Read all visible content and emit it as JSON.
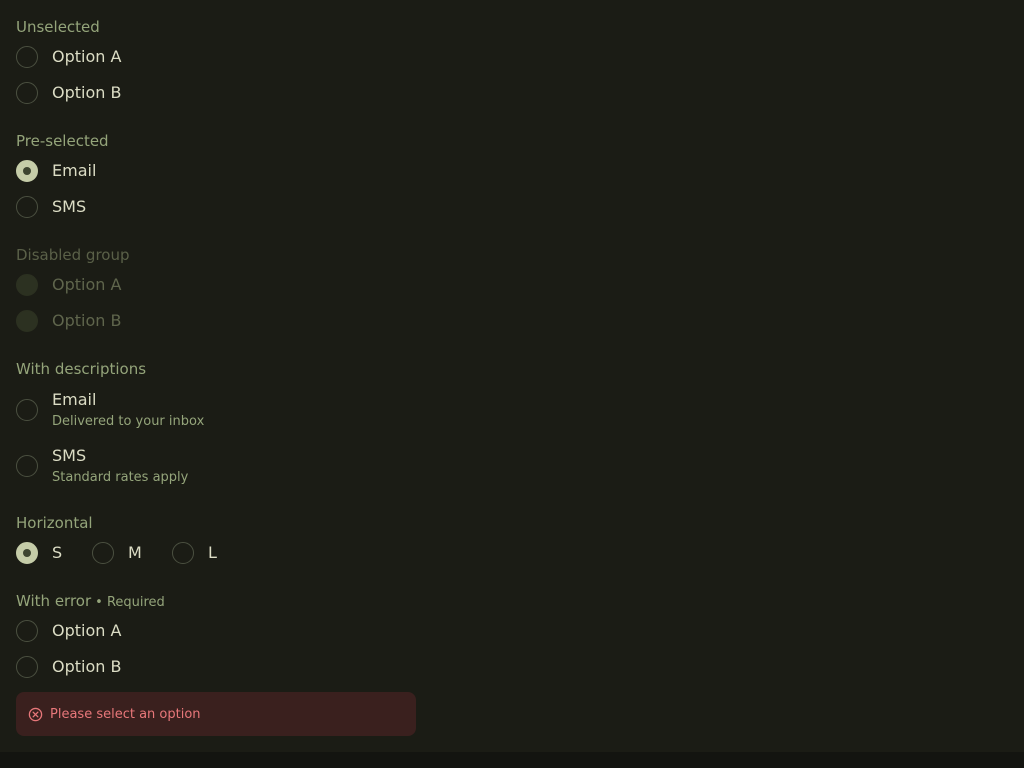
{
  "colors": {
    "background": "#1b1c15",
    "label": "#94a47a",
    "text": "#dcddc5",
    "radio_checked": "#c5cca8",
    "error_bg": "#3a201e",
    "error_text": "#e8777a"
  },
  "groups": {
    "unselected": {
      "label": "Unselected",
      "options": [
        {
          "label": "Option A",
          "checked": false
        },
        {
          "label": "Option B",
          "checked": false
        }
      ]
    },
    "preselected": {
      "label": "Pre-selected",
      "options": [
        {
          "label": "Email",
          "checked": true
        },
        {
          "label": "SMS",
          "checked": false
        }
      ]
    },
    "disabled": {
      "label": "Disabled group",
      "options": [
        {
          "label": "Option A",
          "checked": false
        },
        {
          "label": "Option B",
          "checked": false
        }
      ]
    },
    "descriptions": {
      "label": "With descriptions",
      "options": [
        {
          "label": "Email",
          "description": "Delivered to your inbox",
          "checked": false
        },
        {
          "label": "SMS",
          "description": "Standard rates apply",
          "checked": false
        }
      ]
    },
    "horizontal": {
      "label": "Horizontal",
      "options": [
        {
          "label": "S",
          "checked": true
        },
        {
          "label": "M",
          "checked": false
        },
        {
          "label": "L",
          "checked": false
        }
      ]
    },
    "error": {
      "label": "With error",
      "required": "• Required",
      "options": [
        {
          "label": "Option A",
          "checked": false
        },
        {
          "label": "Option B",
          "checked": false
        }
      ],
      "message": "Please select an option",
      "icon": "error-circle-x-icon"
    }
  }
}
